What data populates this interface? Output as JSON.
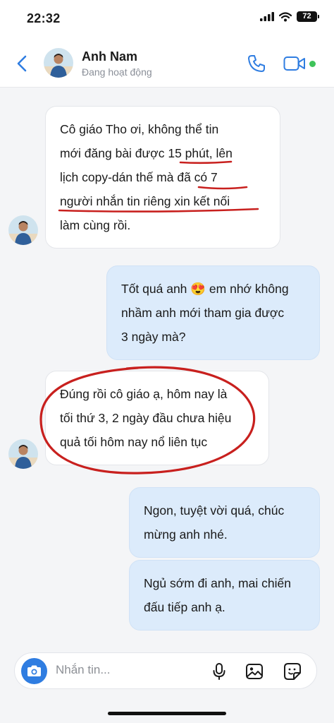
{
  "status_bar": {
    "time": "22:32",
    "battery": "72"
  },
  "header": {
    "contact_name": "Anh Nam",
    "contact_status": "Đang hoạt động"
  },
  "messages": [
    {
      "from": "contact",
      "lines": [
        "Cô giáo Tho ơi, không thể tin",
        "mới đăng bài được 15 phút, lên",
        "lịch copy-dán thế mà đã có 7",
        "người nhắn tin riêng xin kết nối",
        "làm cùng rồi."
      ]
    },
    {
      "from": "me",
      "lines": [
        "Tốt quá anh 😍 em nhớ không",
        "nhầm anh mới tham gia được",
        "3 ngày mà?"
      ]
    },
    {
      "from": "contact",
      "lines": [
        "Đúng rồi cô giáo ạ, hôm nay là",
        "tối thứ 3, 2 ngày đầu chưa hiệu",
        "quả tối hôm nay nổ liên tục"
      ]
    },
    {
      "from": "me",
      "lines": [
        "Ngon, tuyệt vời quá, chúc",
        "mừng anh nhé."
      ]
    },
    {
      "from": "me",
      "lines": [
        "Ngủ sớm đi anh, mai chiến",
        "đấu tiếp anh ạ."
      ]
    }
  ],
  "composer": {
    "placeholder": "Nhắn tin..."
  },
  "icons": {
    "back": "chevron-left-icon",
    "call": "phone-icon",
    "video": "video-camera-icon",
    "camera": "camera-icon",
    "mic": "microphone-icon",
    "image": "image-icon",
    "sticker": "sticker-icon"
  },
  "colors": {
    "accent": "#2f7de1",
    "outgoing_bubble": "#dcebfb",
    "annotation": "#c8201e",
    "online": "#3fc35a"
  }
}
